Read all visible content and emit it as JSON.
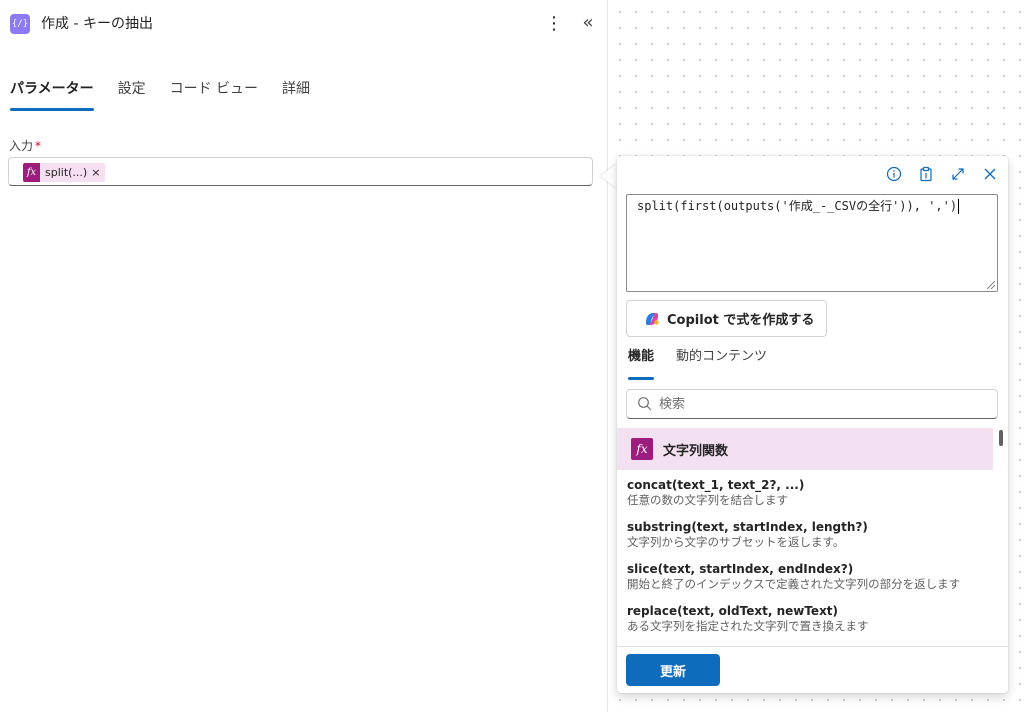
{
  "panel": {
    "title": "作成 - キーの抽出",
    "icon": "code-icon",
    "icon_color": "#8a7bf3",
    "more_icon": "more-vertical-icon",
    "collapse_icon": "chevron-double-left-icon"
  },
  "tabs": [
    {
      "label": "パラメーター",
      "active": true
    },
    {
      "label": "設定"
    },
    {
      "label": "コード ビュー"
    },
    {
      "label": "詳細"
    }
  ],
  "input": {
    "label": "入力",
    "required_mark": "*",
    "token": {
      "label": "split(...)",
      "remove": "×",
      "icon": "fx-icon"
    }
  },
  "expression_editor": {
    "toolbar": [
      "info-icon",
      "clipboard-icon",
      "expand-icon",
      "close-icon"
    ],
    "expression": "split(first(outputs('作成_-_CSVの全行')), ',')",
    "copilot_button": "Copilot で式を作成する",
    "tabs": [
      {
        "label": "機能",
        "active": true
      },
      {
        "label": "動的コンテンツ"
      }
    ],
    "search": {
      "placeholder": "検索",
      "value": ""
    },
    "category": {
      "label": "文字列関数",
      "icon": "fx-icon"
    },
    "functions": [
      {
        "signature": "concat(text_1, text_2?, ...)",
        "description": "任意の数の文字列を結合します"
      },
      {
        "signature": "substring(text, startIndex, length?)",
        "description": "文字列から文字のサブセットを返します。"
      },
      {
        "signature": "slice(text, startIndex, endIndex?)",
        "description": "開始と終了のインデックスで定義された文字列の部分を返します"
      },
      {
        "signature": "replace(text, oldText, newText)",
        "description": "ある文字列を指定された文字列で置き換えます"
      }
    ],
    "update_button": "更新"
  },
  "colors": {
    "accent": "#0f6cbd",
    "fx_badge": "#9c1d7e",
    "category_bg": "#f3e0f1",
    "token_bg": "#f6dff0"
  }
}
